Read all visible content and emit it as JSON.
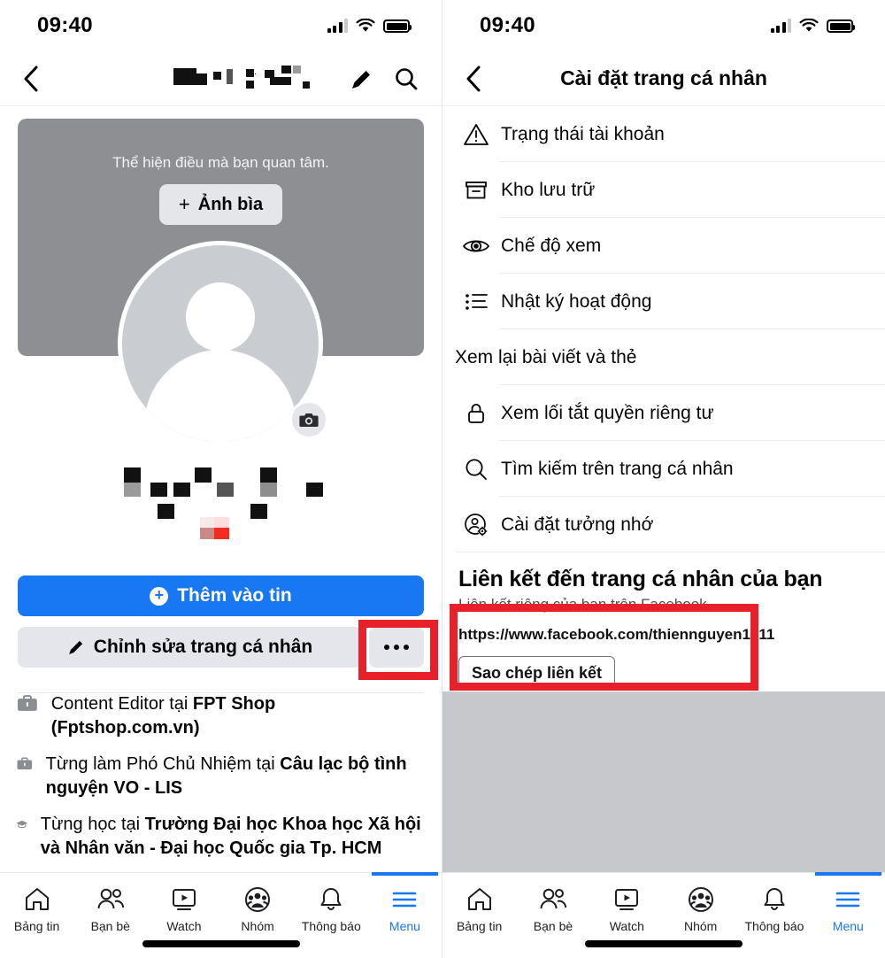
{
  "status_bar": {
    "time": "09:40",
    "signal_icon": "cellular-signal-icon",
    "wifi_icon": "wifi-icon",
    "battery_icon": "battery-full-icon"
  },
  "left_panel": {
    "nav": {
      "back_icon": "chevron-left-icon",
      "title_redacted": "",
      "edit_icon": "pencil-icon",
      "search_icon": "search-icon"
    },
    "cover": {
      "prompt": "Thể hiện điều mà bạn quan tâm.",
      "add_cover_label": "Ảnh bìa",
      "plus": "+",
      "camera_icon": "camera-icon"
    },
    "name_redacted": "",
    "buttons": {
      "add_to_story": "Thêm vào tin",
      "edit_profile": "Chỉnh sửa trang cá nhân",
      "more_label": "•••"
    },
    "bio": [
      {
        "icon": "briefcase-icon",
        "prefix": "",
        "text_plain_1": "Content Editor tại ",
        "text_bold": "FPT Shop (Fptshop.com.vn)",
        "text_plain_2": ""
      },
      {
        "icon": "briefcase-icon",
        "prefix": "",
        "text_plain_1": "Từng làm Phó Chủ Nhiệm tại ",
        "text_bold": "Câu lạc bộ tình nguyện VO - LIS",
        "text_plain_2": ""
      },
      {
        "icon": "graduation-cap-icon",
        "prefix": "",
        "text_plain_1": "Từng học tại ",
        "text_bold": "Trường Đại học Khoa học Xã hội và Nhân văn - Đại học Quốc gia Tp. HCM",
        "text_plain_2": ""
      }
    ]
  },
  "right_panel": {
    "nav": {
      "back_icon": "chevron-left-icon",
      "title": "Cài đặt trang cá nhân"
    },
    "menu_items": [
      {
        "icon": "warning-triangle-icon",
        "label": "Trạng thái tài khoản"
      },
      {
        "icon": "archive-box-icon",
        "label": "Kho lưu trữ"
      },
      {
        "icon": "eye-icon",
        "label": "Chế độ xem"
      },
      {
        "icon": "activity-list-icon",
        "label": "Nhật ký hoạt động"
      },
      {
        "icon": "",
        "label": "Xem lại bài viết và thẻ"
      },
      {
        "icon": "lock-icon",
        "label": "Xem lối tắt quyền riêng tư"
      },
      {
        "icon": "search-icon",
        "label": "Tìm kiếm trên trang cá nhân"
      },
      {
        "icon": "account-gear-icon",
        "label": "Cài đặt tưởng nhớ"
      }
    ],
    "link_section": {
      "title": "Liên kết đến trang cá nhân của bạn",
      "subtitle": "Liên kết riêng của bạn trên Facebook.",
      "url": "https://www.facebook.com/thiennguyen1811",
      "copy_button": "Sao chép liên kết"
    }
  },
  "tab_bar": [
    {
      "icon": "home-icon",
      "label": "Bảng tin",
      "active": false
    },
    {
      "icon": "friends-icon",
      "label": "Bạn bè",
      "active": false
    },
    {
      "icon": "watch-icon",
      "label": "Watch",
      "active": false
    },
    {
      "icon": "groups-icon",
      "label": "Nhóm",
      "active": false
    },
    {
      "icon": "bell-icon",
      "label": "Thông báo",
      "active": false
    },
    {
      "icon": "menu-hamburger-icon",
      "label": "Menu",
      "active": true
    }
  ],
  "annotations": {
    "highlight_color": "#e8202a",
    "boxes": [
      "more-options-button",
      "profile-link-box"
    ]
  },
  "colors": {
    "accent": "#1877f2",
    "cover_gray": "#8d8f92",
    "button_gray": "#e4e6eb",
    "red": "#e8202a"
  }
}
